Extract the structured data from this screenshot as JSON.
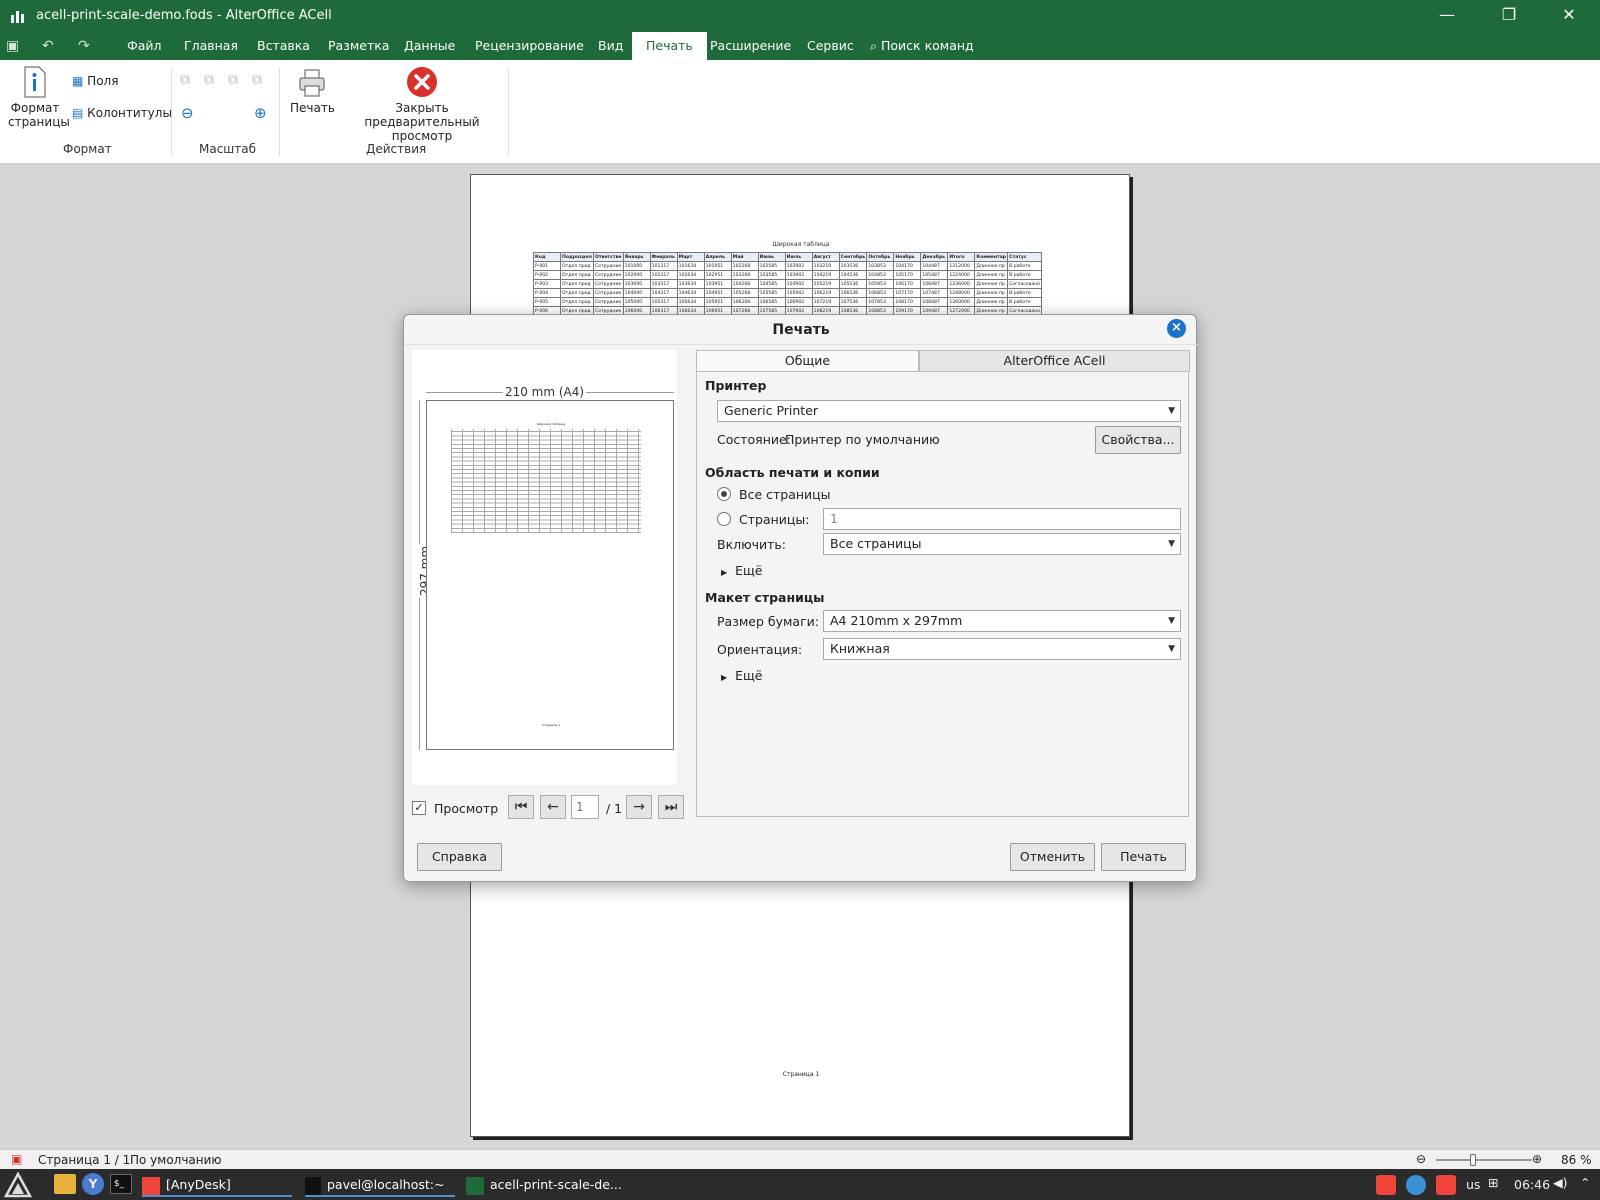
{
  "window": {
    "title": "acell-print-scale-demo.fods - AlterOffice ACell",
    "minimize": "—",
    "maximize": "❐",
    "close": "✕"
  },
  "menu": {
    "items": [
      "Файл",
      "Главная",
      "Вставка",
      "Разметка",
      "Данные",
      "Рецензирование",
      "Вид",
      "Печать",
      "Расширение",
      "Сервис"
    ],
    "active": "Печать",
    "search": "Поиск команд"
  },
  "ribbon": {
    "format": {
      "page_format": "Формат\nстраницы",
      "fields": "Поля",
      "headers_footers": "Колонтитулы",
      "group": "Формат"
    },
    "zoom": {
      "group": "Масштаб"
    },
    "actions": {
      "print": "Печать",
      "close_preview": "Закрыть предварительный\nпросмотр",
      "group": "Действия"
    }
  },
  "sheet": {
    "title": "Широкая таблица",
    "headers": [
      "Код",
      "Подраздел",
      "Ответстве",
      "Январь",
      "Февраль",
      "Март",
      "Апрель",
      "Май",
      "Июнь",
      "Июль",
      "Август",
      "Сентябрь",
      "Октябрь",
      "Ноябрь",
      "Декабрь",
      "Итого",
      "Комментар",
      "Статус"
    ],
    "rows": [
      [
        "P-001",
        "Отдел прод",
        "Сотрудник",
        "101000",
        "101317",
        "101634",
        "101951",
        "102268",
        "102585",
        "102902",
        "103219",
        "103536",
        "103853",
        "104170",
        "104487",
        "1212000",
        "Длинное пр",
        "В работе"
      ],
      [
        "P-002",
        "Отдел прод",
        "Сотрудник",
        "102000",
        "102317",
        "102634",
        "102951",
        "103268",
        "103585",
        "103902",
        "104219",
        "104536",
        "104853",
        "105170",
        "105487",
        "1224000",
        "Длинное пр",
        "В работе"
      ],
      [
        "P-003",
        "Отдел прод",
        "Сотрудник",
        "103000",
        "103317",
        "103634",
        "103951",
        "104268",
        "104585",
        "104902",
        "105219",
        "105536",
        "105853",
        "106170",
        "106487",
        "1236000",
        "Длинное пр",
        "Согласовано"
      ],
      [
        "P-004",
        "Отдел прод",
        "Сотрудник",
        "104000",
        "104317",
        "104634",
        "104951",
        "105268",
        "105585",
        "105902",
        "106219",
        "106536",
        "106853",
        "107170",
        "107487",
        "1248000",
        "Длинное пр",
        "В работе"
      ],
      [
        "P-005",
        "Отдел прод",
        "Сотрудник",
        "105000",
        "105317",
        "105634",
        "105951",
        "106268",
        "106585",
        "106902",
        "107219",
        "107536",
        "107853",
        "108170",
        "108487",
        "1260000",
        "Длинное пр",
        "В работе"
      ],
      [
        "P-006",
        "Отдел прод",
        "Сотрудник",
        "106000",
        "106317",
        "106634",
        "106951",
        "107268",
        "107585",
        "107902",
        "108219",
        "108536",
        "108853",
        "109170",
        "109487",
        "1272000",
        "Длинное пр",
        "Согласовано"
      ]
    ],
    "footer": "Страница 1"
  },
  "dialog": {
    "title": "Печать",
    "preview": {
      "width_label": "210 mm (A4)",
      "height_label": "297 mm",
      "checkbox_label": "Просмотр",
      "page_value": "1",
      "page_total": "/ 1",
      "mini_title": "Широкая таблица",
      "mini_footer": "Страница 1"
    },
    "tabs": [
      "Общие",
      "AlterOffice ACell"
    ],
    "printer": {
      "section": "Принтер",
      "selected": "Generic Printer",
      "status_label": "Состояние:",
      "status_value": "Принтер по умолчанию",
      "properties_button": "Свойства..."
    },
    "range": {
      "section": "Область печати и копии",
      "all_pages": "Все страницы",
      "pages_label": "Страницы:",
      "pages_value": "1",
      "include_label": "Включить:",
      "include_value": "Все страницы",
      "more": "Ещё"
    },
    "layout": {
      "section": "Макет страницы",
      "paper_label": "Размер бумаги:",
      "paper_value": "A4 210mm x 297mm",
      "orientation_label": "Ориентация:",
      "orientation_value": "Книжная",
      "more": "Ещё"
    },
    "buttons": {
      "help": "Справка",
      "cancel": "Отменить",
      "print": "Печать"
    }
  },
  "statusbar": {
    "page": "Страница 1 / 1",
    "style": "По умолчанию",
    "zoom": "86 %"
  },
  "taskbar": {
    "items": [
      "[AnyDesk]",
      "pavel@localhost:~",
      "acell-print-scale-de..."
    ],
    "lang": "us",
    "clock": "06:46"
  },
  "colors": {
    "accent": "#1e6a3a",
    "dialog_close": "#1a73c9",
    "close_preview_icon": "#d9312b"
  }
}
